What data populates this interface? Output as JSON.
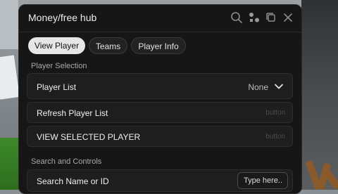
{
  "window": {
    "title": "Money/free hub"
  },
  "titlebar_icons": [
    "search-icon",
    "shapes-icon",
    "minimize-icon",
    "close-icon"
  ],
  "tabs": [
    {
      "label": "View Player",
      "active": true
    },
    {
      "label": "Teams",
      "active": false
    },
    {
      "label": "Player Info",
      "active": false
    }
  ],
  "player_selection": {
    "section_label": "Player Selection",
    "dropdown": {
      "label": "Player List",
      "value": "None"
    },
    "refresh": {
      "label": "Refresh Player List",
      "hint": "button"
    },
    "view": {
      "label": "VIEW SELECTED PLAYER",
      "hint": "button"
    }
  },
  "search_controls": {
    "section_label": "Search and Controls",
    "search": {
      "label": "Search Name or ID",
      "placeholder": "Type here..."
    }
  },
  "colors": {
    "panel": "#161616",
    "row": "#1e1e1e",
    "active_tab": "#e6e6e6"
  }
}
